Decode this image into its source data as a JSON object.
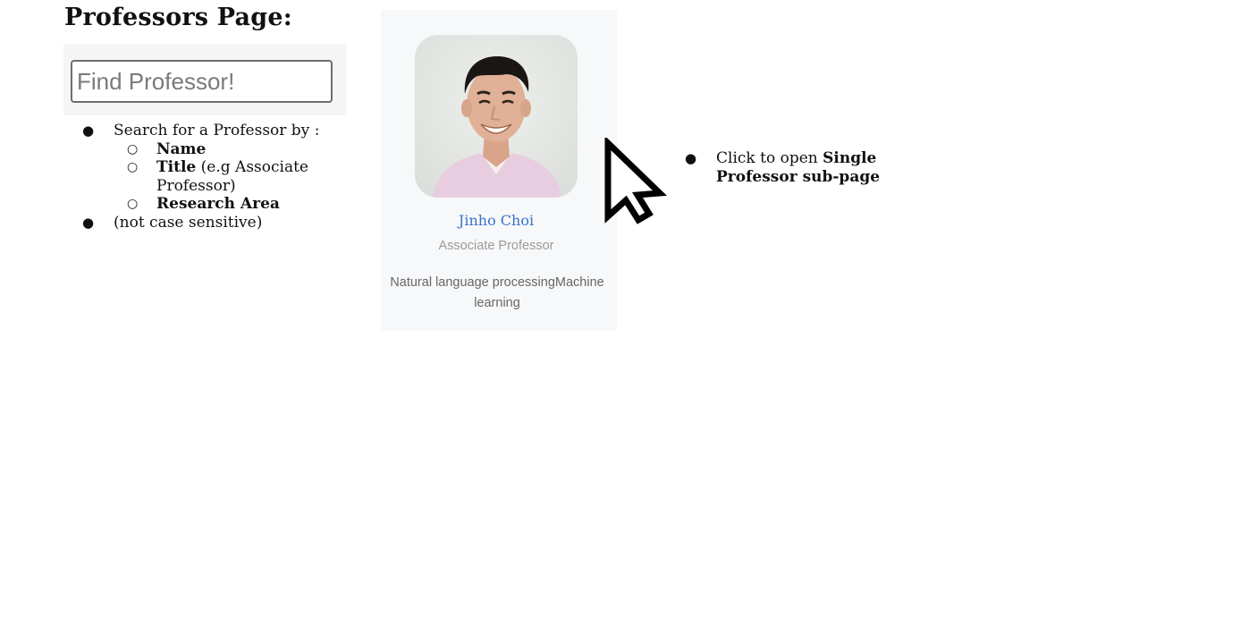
{
  "page": {
    "title": "Professors Page:"
  },
  "search": {
    "placeholder": "Find Professor!",
    "value": ""
  },
  "search_notes": {
    "intro": "Search for a Professor by :",
    "criteria": {
      "name": "Name",
      "title_label": "Title",
      "title_example": " (e.g Associate Professor)",
      "research_area": "Research Area"
    },
    "case_note": "(not case sensitive)"
  },
  "professor_card": {
    "name": "Jinho Choi",
    "title": "Associate Professor",
    "research_areas": "Natural language processingMachine learning",
    "accent_color": "#3a73c9",
    "photo_icon": "professor-photo"
  },
  "click_note": {
    "prefix": "Click to open ",
    "target": "Single Professor sub-page"
  },
  "cursor": {
    "icon": "mouse-pointer-icon"
  }
}
